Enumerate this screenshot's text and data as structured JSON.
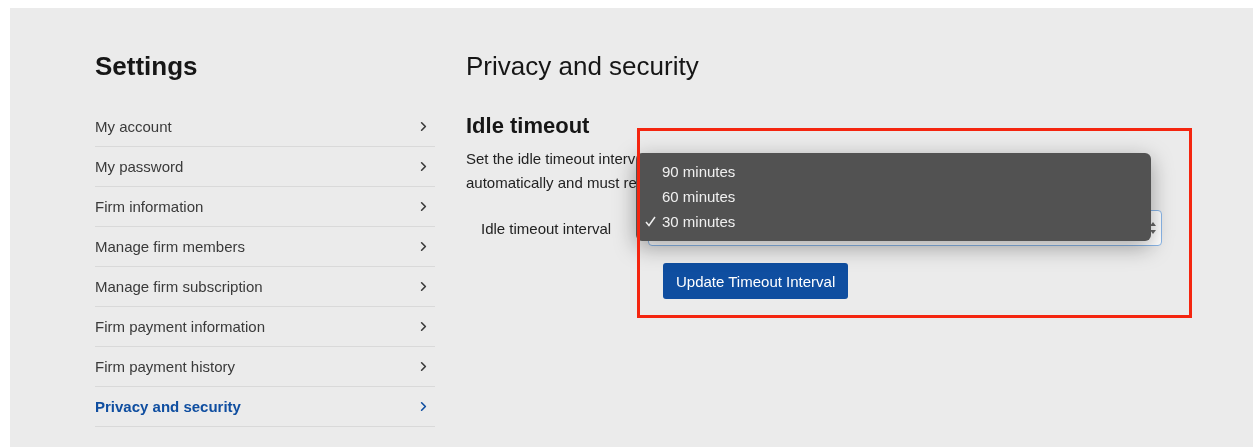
{
  "sidebar": {
    "title": "Settings",
    "items": [
      {
        "label": "My account",
        "selected": false
      },
      {
        "label": "My password",
        "selected": false
      },
      {
        "label": "Firm information",
        "selected": false
      },
      {
        "label": "Manage firm members",
        "selected": false
      },
      {
        "label": "Manage firm subscription",
        "selected": false
      },
      {
        "label": "Firm payment information",
        "selected": false
      },
      {
        "label": "Firm payment history",
        "selected": false
      },
      {
        "label": "Privacy and security",
        "selected": true
      }
    ]
  },
  "main": {
    "title": "Privacy and security",
    "section": {
      "title": "Idle timeout",
      "description_lines": [
        "Set the idle timeout interv",
        "automatically and must re"
      ],
      "field": {
        "label": "Idle timeout interval",
        "options": [
          {
            "label": "90 minutes",
            "selected": false
          },
          {
            "label": "60 minutes",
            "selected": false
          },
          {
            "label": "30 minutes",
            "selected": true
          }
        ]
      },
      "button": "Update Timeout Interval"
    }
  },
  "annotation": {
    "kind": "rectangle"
  }
}
